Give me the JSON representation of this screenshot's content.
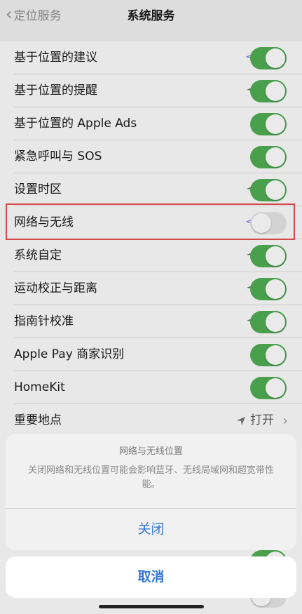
{
  "nav": {
    "back_label": "定位服务",
    "title": "系统服务"
  },
  "rows": [
    {
      "label": "基于位置的建议"
    },
    {
      "label": "基于位置的提醒"
    },
    {
      "label": "基于位置的 Apple Ads"
    },
    {
      "label": "紧急呼叫与 SOS"
    },
    {
      "label": "设置时区"
    },
    {
      "label": "网络与无线"
    },
    {
      "label": "系统自定"
    },
    {
      "label": "运动校正与距离"
    },
    {
      "label": "指南针校准"
    },
    {
      "label": "Apple Pay 商家识别"
    },
    {
      "label": "HomeKit"
    },
    {
      "label": "重要地点",
      "detail": "打开"
    }
  ],
  "toggles": {
    "suggestions": "on",
    "reminders": "on",
    "apple_ads": "on",
    "sos": "on",
    "time_zone": "on",
    "networking": "off",
    "customization": "on",
    "motion": "on",
    "compass": "on",
    "apple_pay": "on",
    "homekit": "on"
  },
  "icons": {
    "arrow_gray": "location-arrow-gray",
    "arrow_purple": "location-arrow-purple",
    "back": "chevron-left",
    "detail": "chevron-right"
  },
  "colors": {
    "toggle_on": "#4ca650",
    "accent": "#3478d6",
    "highlight": "#e14a4a",
    "arrow_purple": "#8f7fe0"
  },
  "sheet": {
    "title": "网络与无线位置",
    "message": "关闭网络和无线位置可能会影响蓝牙、无线局域网和超宽带性能。",
    "action": "关闭",
    "cancel": "取消"
  }
}
